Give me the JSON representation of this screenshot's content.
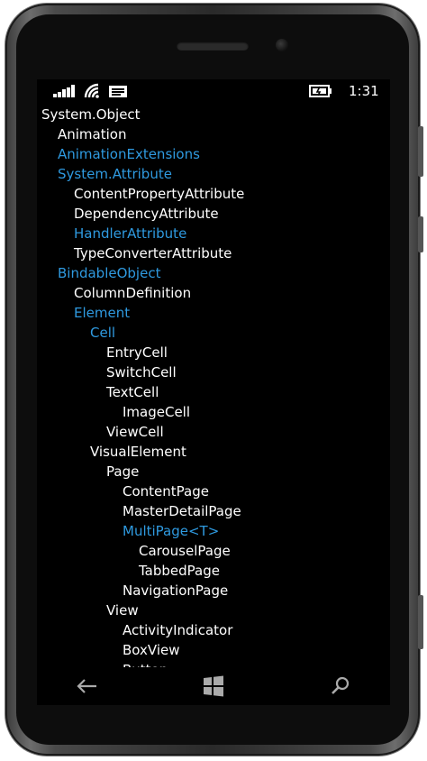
{
  "status_bar": {
    "time": "1:31",
    "icons": [
      "signal-bars-icon",
      "wifi-icon",
      "message-icon",
      "battery-charging-icon"
    ]
  },
  "tree": {
    "items": [
      {
        "label": "System.Object",
        "level": 0,
        "link": false
      },
      {
        "label": "Animation",
        "level": 1,
        "link": false
      },
      {
        "label": "AnimationExtensions",
        "level": 1,
        "link": true
      },
      {
        "label": "System.Attribute",
        "level": 1,
        "link": true
      },
      {
        "label": "ContentPropertyAttribute",
        "level": 2,
        "link": false
      },
      {
        "label": "DependencyAttribute",
        "level": 2,
        "link": false
      },
      {
        "label": "HandlerAttribute",
        "level": 2,
        "link": true
      },
      {
        "label": "TypeConverterAttribute",
        "level": 2,
        "link": false
      },
      {
        "label": "BindableObject",
        "level": 1,
        "link": true
      },
      {
        "label": "ColumnDefinition",
        "level": 2,
        "link": false
      },
      {
        "label": "Element",
        "level": 2,
        "link": true
      },
      {
        "label": "Cell",
        "level": 3,
        "link": true
      },
      {
        "label": "EntryCell",
        "level": 4,
        "link": false
      },
      {
        "label": "SwitchCell",
        "level": 4,
        "link": false
      },
      {
        "label": "TextCell",
        "level": 4,
        "link": false
      },
      {
        "label": "ImageCell",
        "level": 5,
        "link": false
      },
      {
        "label": "ViewCell",
        "level": 4,
        "link": false
      },
      {
        "label": "VisualElement",
        "level": 3,
        "link": false
      },
      {
        "label": "Page",
        "level": 4,
        "link": false
      },
      {
        "label": "ContentPage",
        "level": 5,
        "link": false
      },
      {
        "label": "MasterDetailPage",
        "level": 5,
        "link": false
      },
      {
        "label": "MultiPage<T>",
        "level": 5,
        "link": true
      },
      {
        "label": "CarouselPage",
        "level": 6,
        "link": false
      },
      {
        "label": "TabbedPage",
        "level": 6,
        "link": false
      },
      {
        "label": "NavigationPage",
        "level": 5,
        "link": false
      },
      {
        "label": "View",
        "level": 4,
        "link": false
      },
      {
        "label": "ActivityIndicator",
        "level": 5,
        "link": false
      },
      {
        "label": "BoxView",
        "level": 5,
        "link": false
      },
      {
        "label": "Button",
        "level": 5,
        "link": false
      }
    ]
  },
  "nav_bar": {
    "buttons": [
      "back-icon",
      "windows-start-icon",
      "search-icon"
    ]
  },
  "colors": {
    "background": "#000000",
    "text": "#ffffff",
    "link": "#2f9ae0"
  }
}
